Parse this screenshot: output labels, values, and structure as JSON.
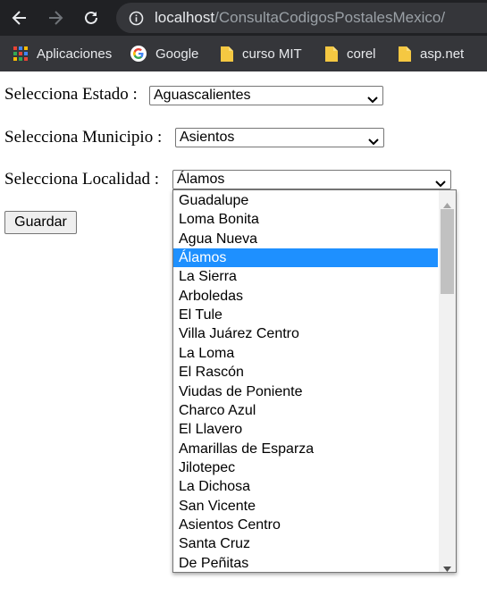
{
  "browser": {
    "url_host": "localhost",
    "url_path": "/ConsultaCodigosPostalesMexico/",
    "bookmarks": [
      {
        "label": "Aplicaciones",
        "icon": "apps-grid-icon"
      },
      {
        "label": "Google",
        "icon": "google-icon"
      },
      {
        "label": "curso MIT",
        "icon": "folder-icon"
      },
      {
        "label": "corel",
        "icon": "folder-icon"
      },
      {
        "label": "asp.net",
        "icon": "folder-icon"
      }
    ]
  },
  "form": {
    "estado_label": "Selecciona Estado :",
    "estado_value": "Aguascalientes",
    "municipio_label": "Selecciona Municipio :",
    "municipio_value": "Asientos",
    "localidad_label": "Selecciona Localidad :",
    "localidad_value": "Álamos",
    "save_label": "Guardar"
  },
  "dropdown": {
    "selected": "Álamos",
    "options": [
      "Guadalupe",
      "Loma Bonita",
      "Agua Nueva",
      "Álamos",
      "La Sierra",
      "Arboledas",
      "El Tule",
      "Villa Juárez Centro",
      "La Loma",
      "El Rascón",
      "Viudas de Poniente",
      "Charco Azul",
      "El Llavero",
      "Amarillas de Esparza",
      "Jilotepec",
      "La Dichosa",
      "San Vicente",
      "Asientos Centro",
      "Santa Cruz",
      "De Peñitas"
    ]
  },
  "colors": {
    "toolbar": "#202124",
    "bookmarks_bar": "#35363a",
    "selection": "#1e90ff",
    "folder": "#f5c842"
  }
}
